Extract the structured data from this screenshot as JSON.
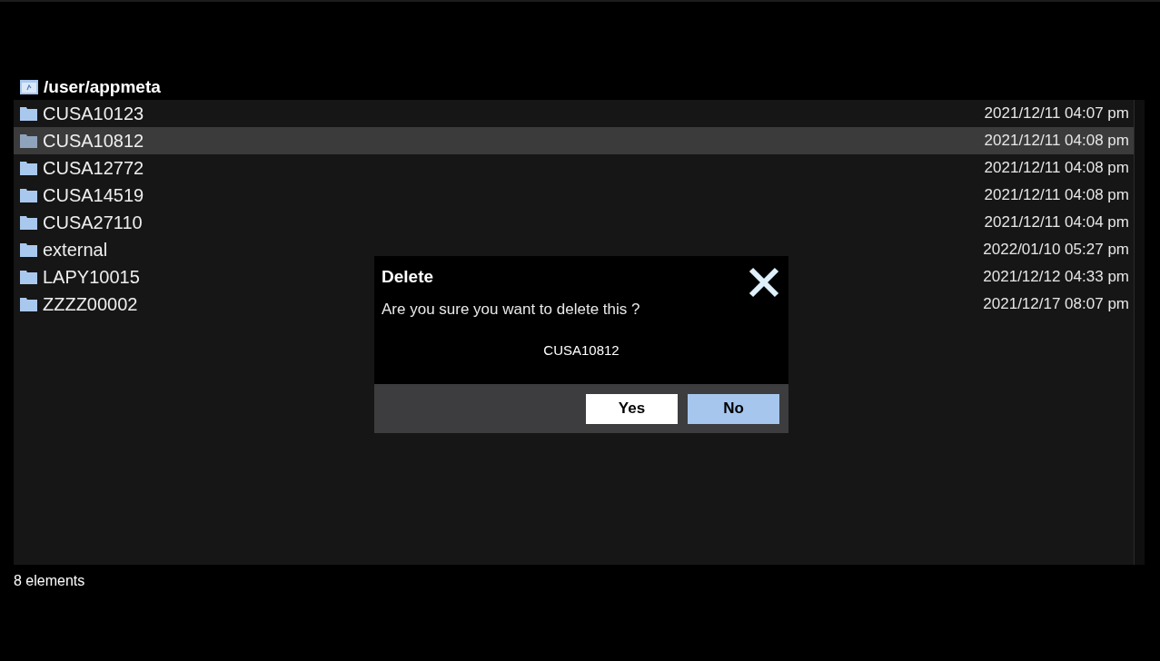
{
  "path": "/user/appmeta",
  "rows": [
    {
      "name": "CUSA10123",
      "date": "2021/12/11 04:07 pm",
      "selected": false
    },
    {
      "name": "CUSA10812",
      "date": "2021/12/11 04:08 pm",
      "selected": true
    },
    {
      "name": "CUSA12772",
      "date": "2021/12/11 04:08 pm",
      "selected": false
    },
    {
      "name": "CUSA14519",
      "date": "2021/12/11 04:08 pm",
      "selected": false
    },
    {
      "name": "CUSA27110",
      "date": "2021/12/11 04:04 pm",
      "selected": false
    },
    {
      "name": "external",
      "date": "2022/01/10 05:27 pm",
      "selected": false
    },
    {
      "name": "LAPY10015",
      "date": "2021/12/12 04:33 pm",
      "selected": false
    },
    {
      "name": "ZZZZ00002",
      "date": "2021/12/17 08:07 pm",
      "selected": false
    }
  ],
  "status_bar": "8 elements",
  "dialog": {
    "title": "Delete",
    "message": "Are you sure you want to delete this ?",
    "item": "CUSA10812",
    "buttons": [
      {
        "label": "Yes",
        "selected": false
      },
      {
        "label": "No",
        "selected": true
      }
    ]
  }
}
